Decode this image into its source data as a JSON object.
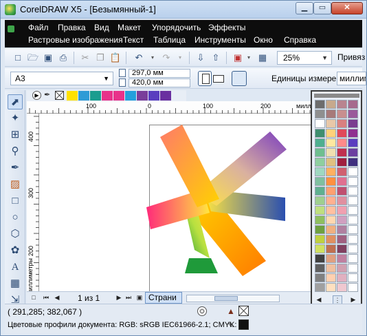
{
  "window": {
    "title": "CorelDRAW X5 - [Безымянный-1]",
    "controls": {
      "minimize": "▁",
      "maximize": "▭",
      "close": "✕"
    }
  },
  "menu": {
    "row1": [
      "Файл",
      "Правка",
      "Вид",
      "Макет",
      "Упорядочить",
      "Эффекты"
    ],
    "row2": [
      "Растровые изображения",
      "Текст",
      "Таблица",
      "Инструменты",
      "Окно",
      "Справка"
    ]
  },
  "toolbar1": {
    "buttons": [
      "new-icon",
      "open-icon",
      "save-icon",
      "print-icon",
      "cut-icon",
      "copy-icon",
      "paste-icon",
      "undo-icon",
      "redo-icon",
      "import-icon",
      "export-icon",
      "publish-icon",
      "welcome-icon"
    ],
    "zoom": "25%",
    "snap_label": "Привяз"
  },
  "toolbar2": {
    "page_size": "A3",
    "width": "297,0 мм",
    "height": "420,0 мм",
    "units_label": "Единицы измерения:",
    "units_value": "миллиме"
  },
  "tools": [
    "pick-tool-icon",
    "shape-tool-icon",
    "crop-tool-icon",
    "zoom-tool-icon",
    "freehand-tool-icon",
    "smart-fill-tool-icon",
    "rectangle-tool-icon",
    "ellipse-tool-icon",
    "polygon-tool-icon",
    "basic-shapes-tool-icon",
    "text-tool-icon",
    "table-tool-icon",
    "dimension-tool-icon"
  ],
  "document_palette": {
    "swatches": [
      "#ffe100",
      "#2e9bd6",
      "#1a9d8f",
      "#e8328a",
      "#e8328a",
      "#24a0dc",
      "#7a3d9a",
      "#5a3dbf",
      "#6a2fa0"
    ]
  },
  "rulers": {
    "top_ticks": [
      "100",
      "0",
      "100",
      "200"
    ],
    "top_unit": "милли",
    "left_ticks": [
      "400",
      "300",
      "200"
    ],
    "left_unit": "миллиметры"
  },
  "page_nav": {
    "counter": "1 из 1",
    "page_tab": "Страни"
  },
  "status": {
    "coords": "( 291,285; 382,067 )",
    "profile": "Цветовые профили документа: RGB: sRGB IEC61966-2.1; CMYK:"
  },
  "color_palette": {
    "colors": [
      [
        "#6d6d6d",
        "#c7a98c",
        "#b9848f",
        "#a66a8e"
      ],
      [
        "#8f8f8f",
        "#a77a7a",
        "#c88f8f",
        "#9a5a9a"
      ],
      [
        "#ffffff",
        "#e8c8a8",
        "#d98080",
        "#7a3d8f"
      ],
      [
        "#3f8f6f",
        "#ffd27a",
        "#e04a5a",
        "#8f2f8f"
      ],
      [
        "#4faf8f",
        "#ffe8a0",
        "#ff8a8a",
        "#5a3dbf"
      ],
      [
        "#6fbf8f",
        "#f0e0b0",
        "#c03050",
        "#6b3fa0"
      ],
      [
        "#8fcf9f",
        "#e0c080",
        "#a02040",
        "#3f2f7f"
      ],
      [
        "#9fd8c0",
        "#ffb060",
        "#d06070",
        "#ffffff"
      ],
      [
        "#7fc0a0",
        "#ff9040",
        "#e07090",
        "#ffffff"
      ],
      [
        "#5fb090",
        "#ffa070",
        "#c05070",
        "#ffffff"
      ],
      [
        "#9fcf8f",
        "#ffb090",
        "#e090a0",
        "#ffffff"
      ],
      [
        "#bfdf7f",
        "#ffc0a0",
        "#f0a0b0",
        "#ffffff"
      ],
      [
        "#8fbf5f",
        "#ffd8b0",
        "#d0a0c0",
        "#ffffff"
      ],
      [
        "#6fa040",
        "#f0b080",
        "#b080a0",
        "#ffffff"
      ],
      [
        "#c0d040",
        "#e09060",
        "#a06080",
        "#ffffff"
      ],
      [
        "#d0e060",
        "#c07050",
        "#804060",
        "#ffffff"
      ],
      [
        "#404040",
        "#e0a080",
        "#c080a0",
        "#ffffff"
      ],
      [
        "#606060",
        "#f0c0a0",
        "#d0a0b0",
        "#ffffff"
      ],
      [
        "#808080",
        "#ffd0b0",
        "#e0b0c0",
        "#ffffff"
      ],
      [
        "#a0a0a0",
        "#ffe0c0",
        "#f0c8d0",
        "#ffffff"
      ]
    ]
  },
  "artwork": {
    "description_hidden": "",
    "gradient_colors": [
      "#ff3b8a",
      "#ff7a3b",
      "#ffd200",
      "#fff06a",
      "#9fe04a",
      "#2fbf4a",
      "#2a4fb0",
      "#7a3dbf",
      "#ff8a00"
    ]
  }
}
